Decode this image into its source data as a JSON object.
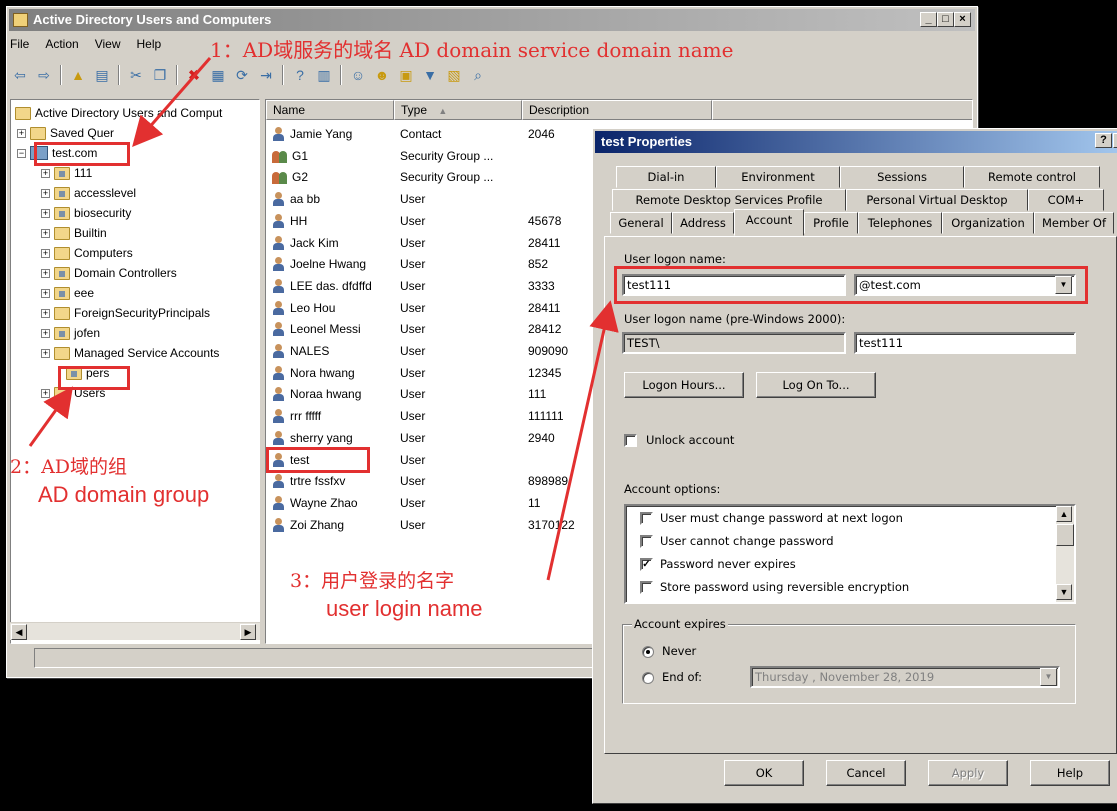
{
  "mmc": {
    "title": "Active Directory Users and Computers",
    "caption_buttons": [
      "_",
      "□",
      "×"
    ],
    "menu": [
      "File",
      "Action",
      "View",
      "Help"
    ],
    "tree": {
      "root": "Active Directory Users and Comput",
      "saved_queries": "Saved Quer",
      "domain": "test.com",
      "children": [
        "111",
        "accesslevel",
        "biosecurity",
        "Builtin",
        "Computers",
        "Domain Controllers",
        "eee",
        "ForeignSecurityPrincipals",
        "jofen",
        "Managed Service Accounts",
        "pers",
        "Users"
      ]
    },
    "list": {
      "columns": [
        "Name",
        "Type",
        "Description"
      ],
      "sort_indicator": "▲",
      "rows": [
        {
          "name": "Jamie Yang",
          "type": "Contact",
          "desc": "2046",
          "icon": "user"
        },
        {
          "name": "G1",
          "type": "Security Group ...",
          "desc": "",
          "icon": "group"
        },
        {
          "name": "G2",
          "type": "Security Group ...",
          "desc": "",
          "icon": "group"
        },
        {
          "name": "aa bb",
          "type": "User",
          "desc": "",
          "icon": "user"
        },
        {
          "name": "HH",
          "type": "User",
          "desc": "45678",
          "icon": "user"
        },
        {
          "name": "Jack Kim",
          "type": "User",
          "desc": "28411",
          "icon": "user"
        },
        {
          "name": "Joelne Hwang",
          "type": "User",
          "desc": "852",
          "icon": "user"
        },
        {
          "name": "LEE das. dfdffd",
          "type": "User",
          "desc": "3333",
          "icon": "user"
        },
        {
          "name": "Leo Hou",
          "type": "User",
          "desc": "28411",
          "icon": "user"
        },
        {
          "name": "Leonel Messi",
          "type": "User",
          "desc": "28412",
          "icon": "user"
        },
        {
          "name": "NALES",
          "type": "User",
          "desc": "909090",
          "icon": "user"
        },
        {
          "name": "Nora hwang",
          "type": "User",
          "desc": "12345",
          "icon": "user"
        },
        {
          "name": "Noraa hwang",
          "type": "User",
          "desc": "111",
          "icon": "user"
        },
        {
          "name": "rrr fffff",
          "type": "User",
          "desc": "111111",
          "icon": "user"
        },
        {
          "name": "sherry yang",
          "type": "User",
          "desc": "2940",
          "icon": "user"
        },
        {
          "name": "test",
          "type": "User",
          "desc": "",
          "icon": "user"
        },
        {
          "name": "trtre fssfxv",
          "type": "User",
          "desc": "898989",
          "icon": "user"
        },
        {
          "name": "Wayne Zhao",
          "type": "User",
          "desc": "11",
          "icon": "user"
        },
        {
          "name": "Zoi Zhang",
          "type": "User",
          "desc": "3170122",
          "icon": "user"
        }
      ]
    }
  },
  "dialog": {
    "title": "test Properties",
    "help_btn": "?",
    "close_btn": "×",
    "tabs_row1": [
      "Dial-in",
      "Environment",
      "Sessions",
      "Remote control"
    ],
    "tabs_row2": [
      "Remote Desktop Services Profile",
      "Personal Virtual Desktop",
      "COM+"
    ],
    "tabs_row3": [
      "General",
      "Address",
      "Account",
      "Profile",
      "Telephones",
      "Organization",
      "Member Of"
    ],
    "logon_label": "User logon name:",
    "logon_value": "test111",
    "domain_value": "@test.com",
    "pre2000_label": "User logon name (pre-Windows 2000):",
    "pre2000_domain": "TEST\\",
    "pre2000_value": "test111",
    "logon_hours": "Logon Hours...",
    "log_on_to": "Log On To...",
    "unlock": "Unlock account",
    "options_label": "Account options:",
    "options": [
      {
        "label": "User must change password at next logon",
        "checked": false
      },
      {
        "label": "User cannot change password",
        "checked": false
      },
      {
        "label": "Password never expires",
        "checked": true
      },
      {
        "label": "Store password using reversible encryption",
        "checked": false
      }
    ],
    "expires_label": "Account expires",
    "never": "Never",
    "end_of": "End of:",
    "end_date": "Thursday  , November 28, 2019",
    "ok": "OK",
    "cancel": "Cancel",
    "apply": "Apply",
    "help": "Help"
  },
  "annotations": {
    "a1": "1：AD域服务的域名 AD domain service domain name",
    "a2_line1": "2：AD域的组",
    "a2_line2": "AD domain group",
    "a3_line1": "3：用户登录的名字",
    "a3_line2": "user login name",
    "color": "#e23030"
  }
}
